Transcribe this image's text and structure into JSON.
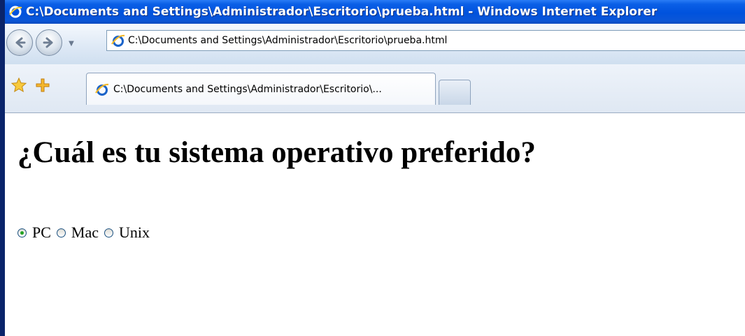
{
  "window": {
    "title": "C:\\Documents and Settings\\Administrador\\Escritorio\\prueba.html - Windows Internet Explorer"
  },
  "navbar": {
    "address": "C:\\Documents and Settings\\Administrador\\Escritorio\\prueba.html",
    "icons": [
      "back-arrow-icon",
      "forward-arrow-icon",
      "chevron-down-icon",
      "ie-page-icon"
    ]
  },
  "tabs": {
    "active_label": "C:\\Documents and Settings\\Administrador\\Escritorio\\...",
    "icons": [
      "favorites-star-icon",
      "add-favorite-icon"
    ]
  },
  "page": {
    "heading": "¿Cuál es tu sistema operativo preferido?",
    "options": [
      {
        "label": "PC",
        "checked": true
      },
      {
        "label": "Mac",
        "checked": false
      },
      {
        "label": "Unix",
        "checked": false
      }
    ]
  },
  "colors": {
    "titlebar": "#0052dd",
    "radio_dot": "#21a121",
    "frame_border": "#0a246a"
  }
}
